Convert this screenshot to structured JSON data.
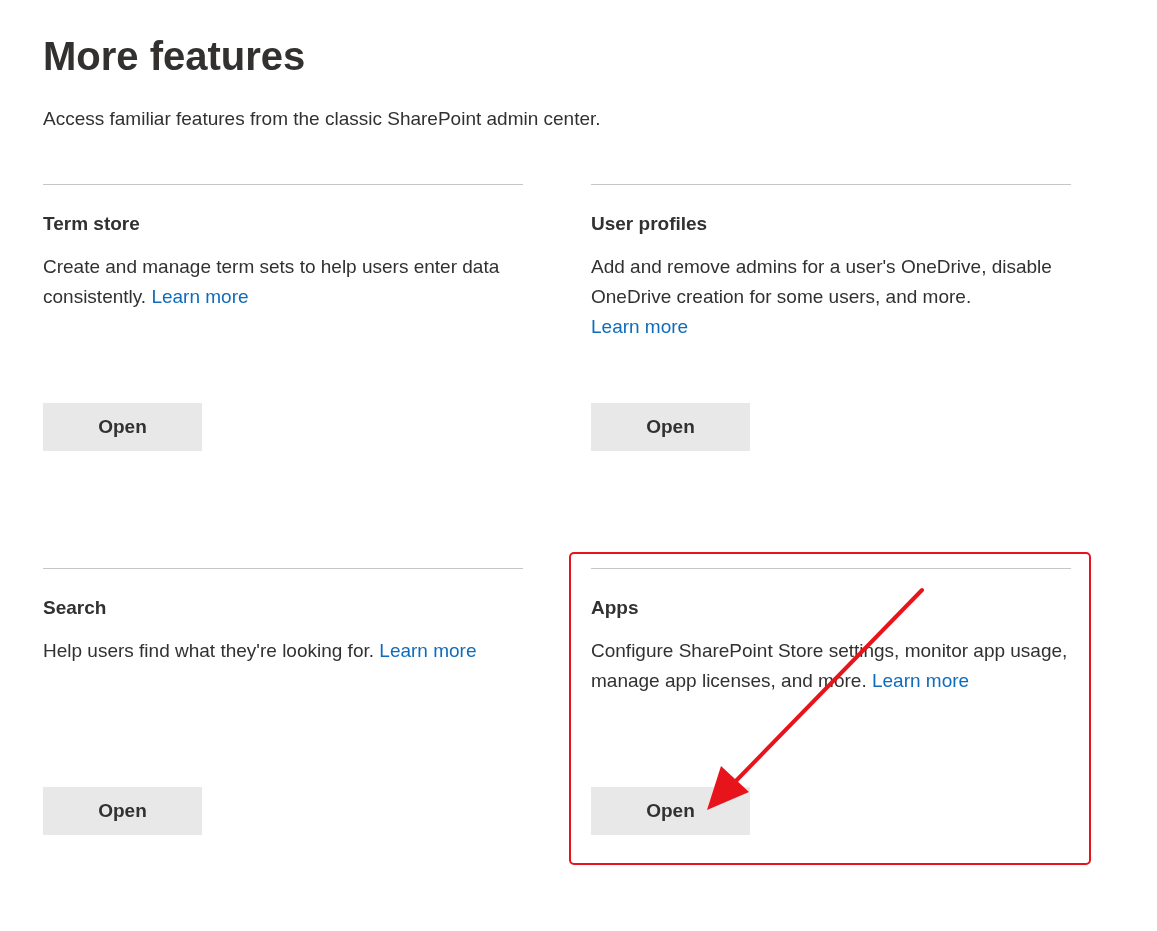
{
  "page": {
    "title": "More features",
    "subtitle": "Access familiar features from the classic SharePoint admin center."
  },
  "cards": [
    {
      "title": "Term store",
      "description": "Create and manage term sets to help users enter data consistently.",
      "link": "Learn more",
      "button": "Open",
      "highlighted": false
    },
    {
      "title": "User profiles",
      "description": "Add and remove admins for a user's OneDrive, disable OneDrive creation for some users, and more.",
      "link": "Learn more",
      "button": "Open",
      "highlighted": false
    },
    {
      "title": "Search",
      "description": "Help users find what they're looking for.",
      "link": "Learn more",
      "button": "Open",
      "highlighted": false
    },
    {
      "title": "Apps",
      "description": "Configure SharePoint Store settings, monitor app usage, manage app licenses, and more.",
      "link": "Learn more",
      "button": "Open",
      "highlighted": true
    }
  ]
}
